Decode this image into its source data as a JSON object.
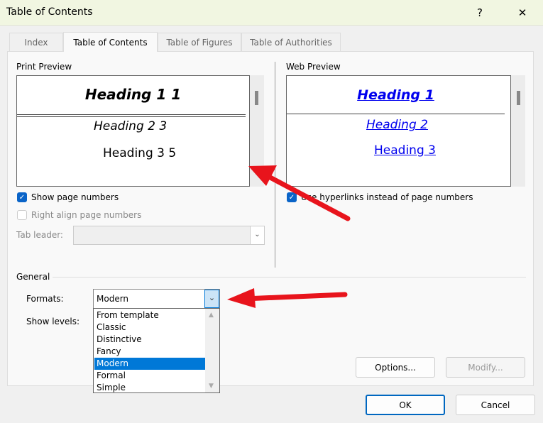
{
  "window": {
    "title": "Table of Contents",
    "help": "?",
    "close": "✕"
  },
  "tabs": [
    {
      "label": "Index"
    },
    {
      "label": "Table of Contents"
    },
    {
      "label": "Table of Figures"
    },
    {
      "label": "Table of Authorities"
    }
  ],
  "print_preview": {
    "label": "Print Preview",
    "h1": "Heading 1 1",
    "h2": "Heading 2 3",
    "h3": "Heading 3 5"
  },
  "web_preview": {
    "label": "Web Preview",
    "h1": "Heading 1",
    "h2": "Heading 2",
    "h3": "Heading 3"
  },
  "options": {
    "show_page_numbers": "Show page numbers",
    "right_align": "Right align page numbers",
    "tab_leader": "Tab leader:",
    "use_hyperlinks": "Use hyperlinks instead of page numbers"
  },
  "general": {
    "label": "General",
    "formats_label": "Formats:",
    "formats_value": "Modern",
    "show_levels_label": "Show levels:",
    "format_options": [
      "From template",
      "Classic",
      "Distinctive",
      "Fancy",
      "Modern",
      "Formal",
      "Simple"
    ]
  },
  "buttons": {
    "options": "Options...",
    "modify": "Modify...",
    "ok": "OK",
    "cancel": "Cancel"
  },
  "colors": {
    "accent": "#0078d7",
    "arrow": "#e8141c",
    "titlebar": "#f1f6e1"
  }
}
